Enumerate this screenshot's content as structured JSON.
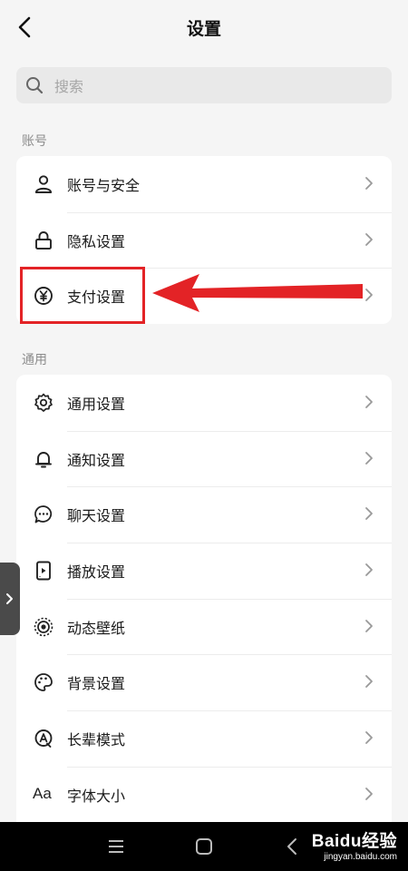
{
  "header": {
    "title": "设置"
  },
  "search": {
    "placeholder": "搜索"
  },
  "sections": [
    {
      "label": "账号",
      "items": [
        {
          "label": "账号与安全",
          "icon": "person-icon"
        },
        {
          "label": "隐私设置",
          "icon": "lock-icon"
        },
        {
          "label": "支付设置",
          "icon": "yen-icon"
        }
      ]
    },
    {
      "label": "通用",
      "items": [
        {
          "label": "通用设置",
          "icon": "gear-icon"
        },
        {
          "label": "通知设置",
          "icon": "bell-icon"
        },
        {
          "label": "聊天设置",
          "icon": "chat-bubble-icon"
        },
        {
          "label": "播放设置",
          "icon": "play-device-icon"
        },
        {
          "label": "动态壁纸",
          "icon": "dynamic-wallpaper-icon"
        },
        {
          "label": "背景设置",
          "icon": "palette-icon"
        },
        {
          "label": "长辈模式",
          "icon": "elder-mode-icon"
        },
        {
          "label": "字体大小",
          "icon": "font-size-icon",
          "icon_text": "Aa"
        }
      ]
    }
  ],
  "annotation": {
    "color": "#e32326"
  },
  "watermark": {
    "brand": "Bai⁠du经验",
    "url": "jingyan.baidu.com"
  }
}
